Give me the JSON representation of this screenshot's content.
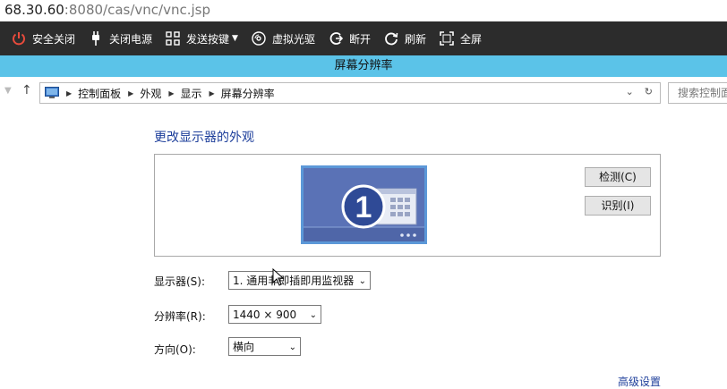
{
  "browser": {
    "url_host": "68.30.60",
    "url_rest": ":8080/cas/vnc/vnc.jsp"
  },
  "toolbar": {
    "items": [
      {
        "label": "安全关闭",
        "icon": "power-icon"
      },
      {
        "label": "关闭电源",
        "icon": "plug-icon"
      },
      {
        "label": "发送按键",
        "icon": "keyboard-icon",
        "dropdown": true
      },
      {
        "label": "虚拟光驱",
        "icon": "disc-icon"
      },
      {
        "label": "断开",
        "icon": "disconnect-icon"
      },
      {
        "label": "刷新",
        "icon": "refresh-icon"
      },
      {
        "label": "全屏",
        "icon": "fullscreen-icon"
      }
    ]
  },
  "window": {
    "title": "屏幕分辨率"
  },
  "address": {
    "crumbs": [
      "控制面板",
      "外观",
      "显示",
      "屏幕分辨率"
    ],
    "search_placeholder": "搜索控制面"
  },
  "main": {
    "heading": "更改显示器的外观",
    "monitor_number": "1",
    "detect_label": "检测(C)",
    "identify_label": "识别(I)",
    "display_label": "显示器(S):",
    "display_value": "1. 通用非即插即用监视器",
    "resolution_label": "分辨率(R):",
    "resolution_value": "1440 × 900",
    "orientation_label": "方向(O):",
    "orientation_value": "横向",
    "advanced_link": "高级设置"
  },
  "colors": {
    "toolbar_bg": "#2c2c2c",
    "title_bar": "#5bc3e8",
    "heading": "#1e3f9b",
    "power_red": "#e84b3c"
  }
}
